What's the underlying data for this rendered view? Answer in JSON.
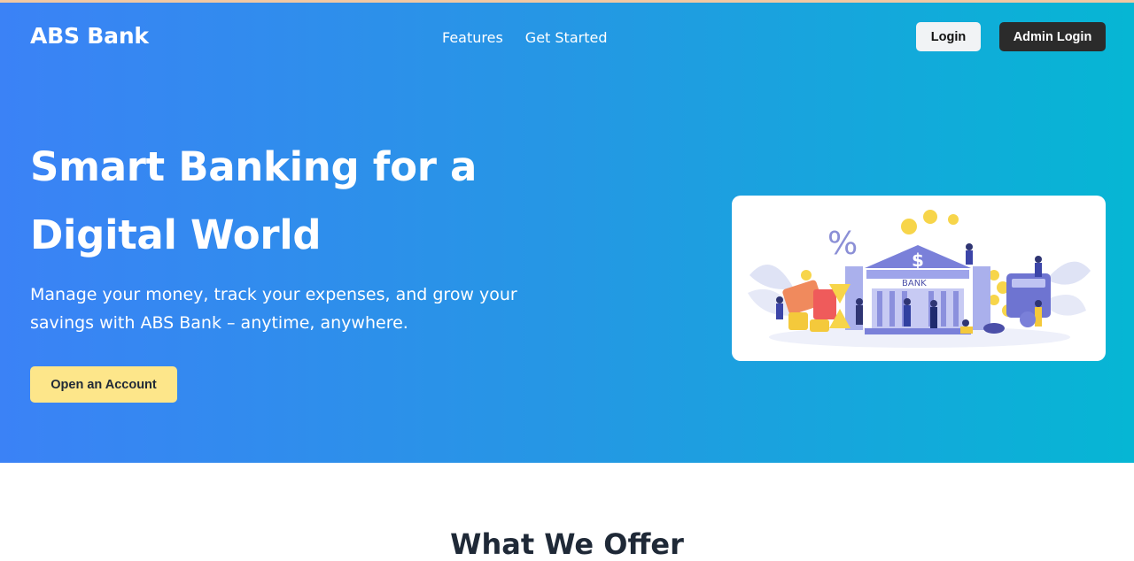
{
  "header": {
    "brand": "ABS Bank",
    "nav": [
      "Features",
      "Get Started"
    ],
    "login_label": "Login",
    "admin_login_label": "Admin Login"
  },
  "hero": {
    "headline": "Smart Banking for a Digital World",
    "subtext": "Manage your money, track your expenses, and grow your savings with ABS Bank – anytime, anywhere.",
    "cta_label": "Open an Account",
    "illustration": {
      "bank_sign": "BANK",
      "percent_sign": "%",
      "dollar_sign": "$"
    }
  },
  "sections": {
    "offer_title": "What We Offer"
  },
  "colors": {
    "gradient_start": "#3b82f6",
    "gradient_end": "#06b6d4",
    "cta_bg": "#fde68a",
    "admin_btn_bg": "#2b2b2b"
  }
}
